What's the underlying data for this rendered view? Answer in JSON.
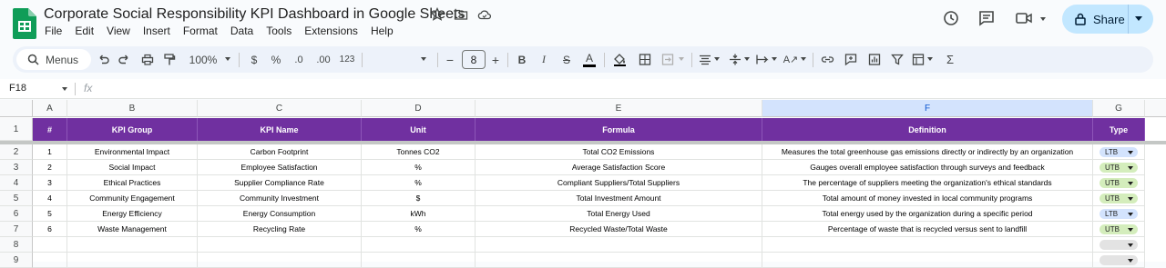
{
  "doc_title": "Corporate Social Responsibility KPI Dashboard in Google Sheets",
  "menu": [
    "File",
    "Edit",
    "View",
    "Insert",
    "Format",
    "Data",
    "Tools",
    "Extensions",
    "Help"
  ],
  "share_label": "Share",
  "toolbar": {
    "search_label": "Menus",
    "zoom": "100%",
    "currency": "$",
    "percent": "%",
    "decrease_decimal": ".0",
    "increase_decimal": ".00",
    "number_format": "123",
    "font_size": "8"
  },
  "name_box": "F18",
  "fx_label": "fx",
  "columns": [
    "A",
    "B",
    "C",
    "D",
    "E",
    "F",
    "G"
  ],
  "rows": [
    "1",
    "2",
    "3",
    "4",
    "5",
    "6",
    "7",
    "8",
    "9"
  ],
  "headers": [
    "#",
    "KPI Group",
    "KPI Name",
    "Unit",
    "Formula",
    "Definition",
    "Type"
  ],
  "data_rows": [
    {
      "num": "1",
      "group": "Environmental Impact",
      "name": "Carbon Footprint",
      "unit": "Tonnes CO2",
      "formula": "Total CO2 Emissions",
      "definition": "Measures the total greenhouse gas emissions directly or indirectly by an organization",
      "type": "LTB"
    },
    {
      "num": "2",
      "group": "Social Impact",
      "name": "Employee Satisfaction",
      "unit": "%",
      "formula": "Average Satisfaction Score",
      "definition": "Gauges overall employee satisfaction through surveys and feedback",
      "type": "UTB"
    },
    {
      "num": "3",
      "group": "Ethical Practices",
      "name": "Supplier Compliance Rate",
      "unit": "%",
      "formula": "Compliant Suppliers/Total Suppliers",
      "definition": "The percentage of suppliers meeting the organization's ethical standards",
      "type": "UTB"
    },
    {
      "num": "4",
      "group": "Community Engagement",
      "name": "Community Investment",
      "unit": "$",
      "formula": "Total Investment Amount",
      "definition": "Total amount of money invested in local community programs",
      "type": "UTB"
    },
    {
      "num": "5",
      "group": "Energy Efficiency",
      "name": "Energy Consumption",
      "unit": "kWh",
      "formula": "Total Energy Used",
      "definition": "Total energy used by the organization during a specific period",
      "type": "LTB"
    },
    {
      "num": "6",
      "group": "Waste Management",
      "name": "Recycling Rate",
      "unit": "%",
      "formula": "Recycled Waste/Total Waste",
      "definition": "Percentage of waste that is recycled versus sent to landfill",
      "type": "UTB"
    }
  ],
  "colors": {
    "header_purple": "#7030a0",
    "ltb_chip": "#d3e3fd",
    "utb_chip": "#d4edbc",
    "empty_chip": "#e3e3e3",
    "share_bg": "#c2e7ff"
  }
}
